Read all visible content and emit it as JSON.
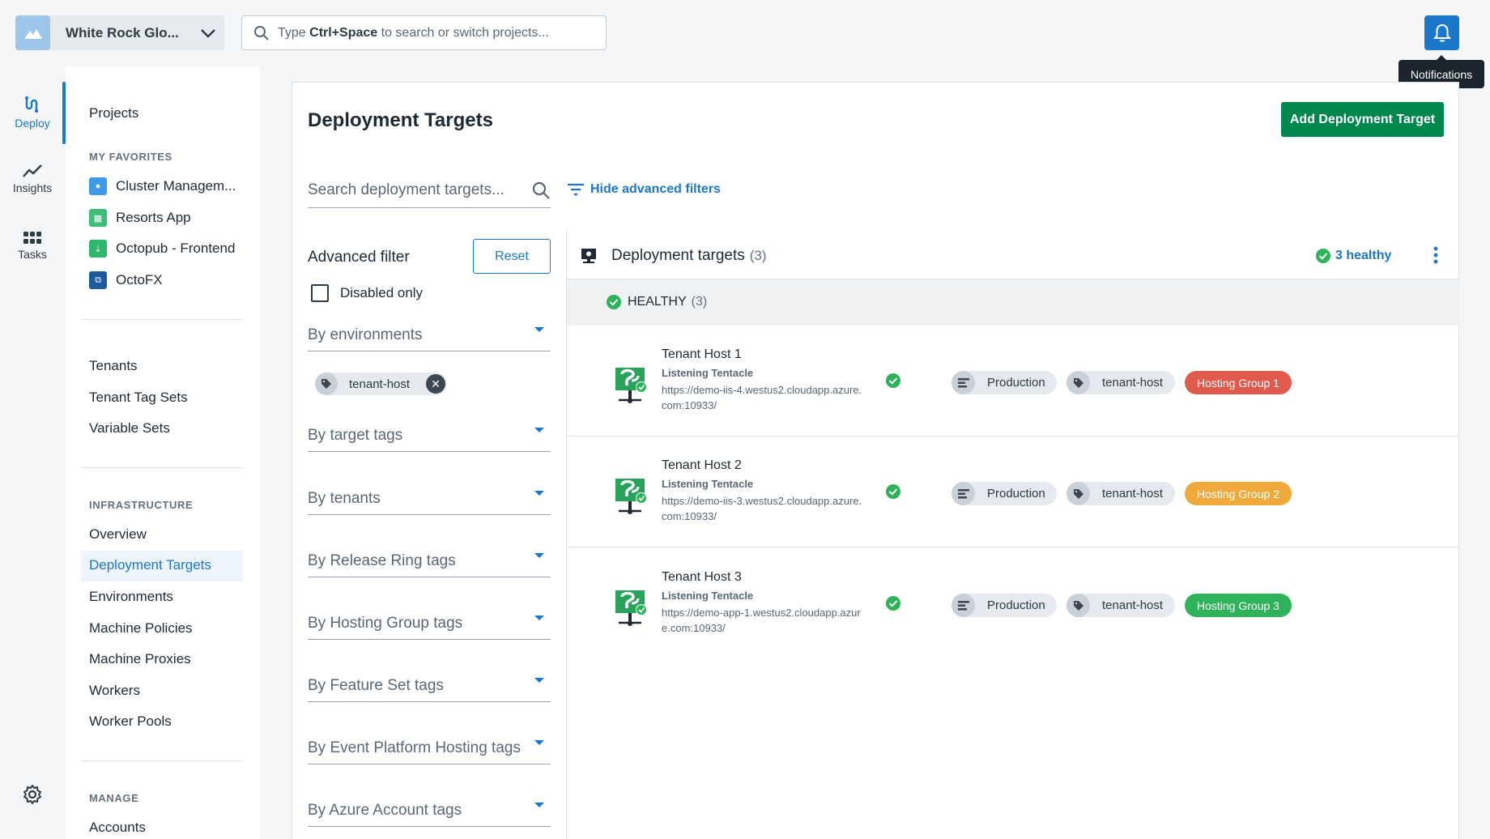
{
  "topbar": {
    "space_name": "White Rock Glo...",
    "search_prefix": "Type ",
    "search_bold": "Ctrl+Space",
    "search_suffix": " to search or switch projects...",
    "notifications_tooltip": "Notifications"
  },
  "rail": {
    "items": [
      {
        "label": "Deploy",
        "icon": "deploy-icon"
      },
      {
        "label": "Insights",
        "icon": "insights-icon"
      },
      {
        "label": "Tasks",
        "icon": "tasks-icon"
      }
    ]
  },
  "nav": {
    "projects": "Projects",
    "favorites_heading": "MY FAVORITES",
    "favorites": [
      {
        "label": "Cluster Managem...",
        "color": "#3f9ae8"
      },
      {
        "label": "Resorts App",
        "color": "#3dbd77"
      },
      {
        "label": "Octopub - Frontend",
        "color": "#2fb86d"
      },
      {
        "label": "OctoFX",
        "color": "#1d5a9c"
      }
    ],
    "tenants": "Tenants",
    "tenant_tag_sets": "Tenant Tag Sets",
    "variable_sets": "Variable Sets",
    "infra_heading": "INFRASTRUCTURE",
    "overview": "Overview",
    "deployment_targets": "Deployment Targets",
    "environments": "Environments",
    "machine_policies": "Machine Policies",
    "machine_proxies": "Machine Proxies",
    "workers": "Workers",
    "worker_pools": "Worker Pools",
    "manage_heading": "MANAGE",
    "accounts": "Accounts"
  },
  "main": {
    "title": "Deployment Targets",
    "add_button": "Add Deployment Target",
    "search_placeholder": "Search deployment targets...",
    "hide_filters": "Hide advanced filters",
    "advanced_filter": "Advanced filter",
    "reset": "Reset",
    "disabled_only": "Disabled only",
    "filters": {
      "environments": "By environments",
      "target_tags": "By target tags",
      "tenants": "By tenants",
      "release_ring": "By Release Ring tags",
      "hosting_group": "By Hosting Group tags",
      "feature_set": "By Feature Set tags",
      "event_platform": "By Event Platform Hosting tags",
      "azure_account": "By Azure Account tags"
    },
    "selected_chip": "tenant-host"
  },
  "targets": {
    "header": "Deployment targets",
    "count": "(3)",
    "healthy_summary": "3 healthy",
    "group_label": "HEALTHY",
    "group_count": "(3)",
    "status_color": "#2eb35b",
    "rows": [
      {
        "name": "Tenant Host 1",
        "type": "Listening Tentacle",
        "url": "https://demo-iis-4.westus2.cloudapp.azure.com:10933/",
        "env": "Production",
        "tag": "tenant-host",
        "group": "Hosting Group 1",
        "group_color": "#e05a4e"
      },
      {
        "name": "Tenant Host 2",
        "type": "Listening Tentacle",
        "url": "https://demo-iis-3.westus2.cloudapp.azure.com:10933/",
        "env": "Production",
        "tag": "tenant-host",
        "group": "Hosting Group 2",
        "group_color": "#f0a93b"
      },
      {
        "name": "Tenant Host 3",
        "type": "Listening Tentacle",
        "url": "https://demo-app-1.westus2.cloudapp.azure.com:10933/",
        "env": "Production",
        "tag": "tenant-host",
        "group": "Hosting Group 3",
        "group_color": "#2eb35b"
      }
    ]
  }
}
